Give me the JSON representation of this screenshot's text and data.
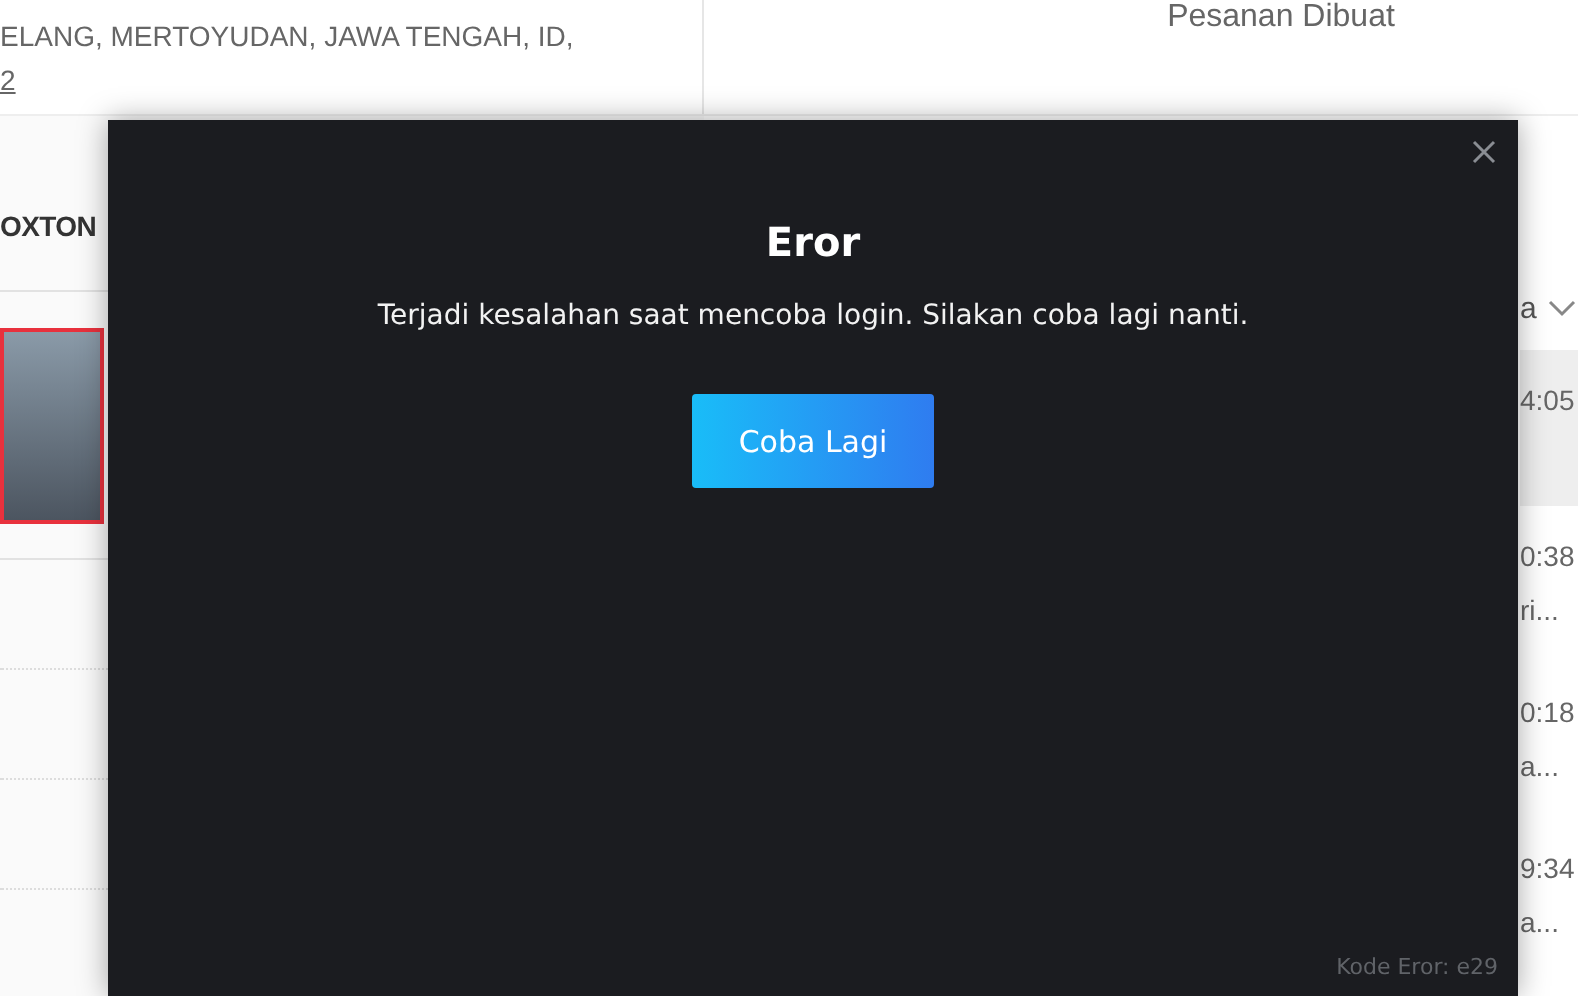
{
  "background": {
    "address_line": "ELANG, MERTOYUDAN, JAWA TENGAH, ID,",
    "address_line_2": "2",
    "column_heading": "Pesanan Dibuat",
    "store_name": "OXTON",
    "sort_label": "a",
    "orders": [
      {
        "time": "4:05",
        "selected": true
      },
      {
        "time": "0:38",
        "detail": "ri...",
        "selected": false
      },
      {
        "time": "0:18",
        "detail": "a...",
        "selected": false
      },
      {
        "time": "9:34",
        "detail": "a...",
        "selected": false
      }
    ]
  },
  "dialog": {
    "title": "Eror",
    "message": "Terjadi kesalahan saat mencoba login. Silakan coba lagi nanti.",
    "button": "Coba Lagi",
    "error_code": "Kode Eror: e29"
  }
}
